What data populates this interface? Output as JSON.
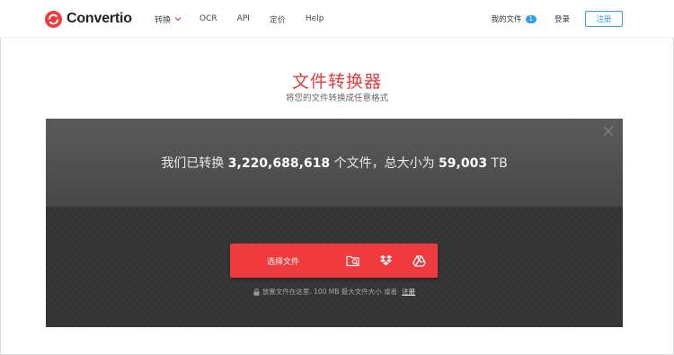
{
  "header": {
    "logo_text": "Convertio",
    "nav": [
      {
        "label": "转换",
        "has_dropdown": true
      },
      {
        "label": "OCR"
      },
      {
        "label": "API"
      },
      {
        "label": "定价"
      },
      {
        "label": "Help"
      }
    ],
    "my_files_label": "我的文件",
    "my_files_count": "1",
    "login_label": "登录",
    "register_label": "注册"
  },
  "hero": {
    "title": "文件转换器",
    "subtitle": "将您的文件转换成任意格式"
  },
  "stats": {
    "prefix": "我们已转换",
    "files_count": "3,220,688,618",
    "middle": "个文件，总大小为",
    "total_size": "59,003",
    "unit": "TB"
  },
  "upload": {
    "choose_label": "选择文件",
    "icons": [
      "folder-search-icon",
      "dropbox-icon",
      "google-drive-icon"
    ],
    "hint_text": "放置文件在这里. 100 MB 最大文件大小 或者",
    "hint_link": "注册"
  },
  "colors": {
    "brand_red": "#ef3b3d",
    "title_red": "#e93a3c",
    "accent_blue": "#2f9ee8",
    "panel_dark": "#343434"
  }
}
